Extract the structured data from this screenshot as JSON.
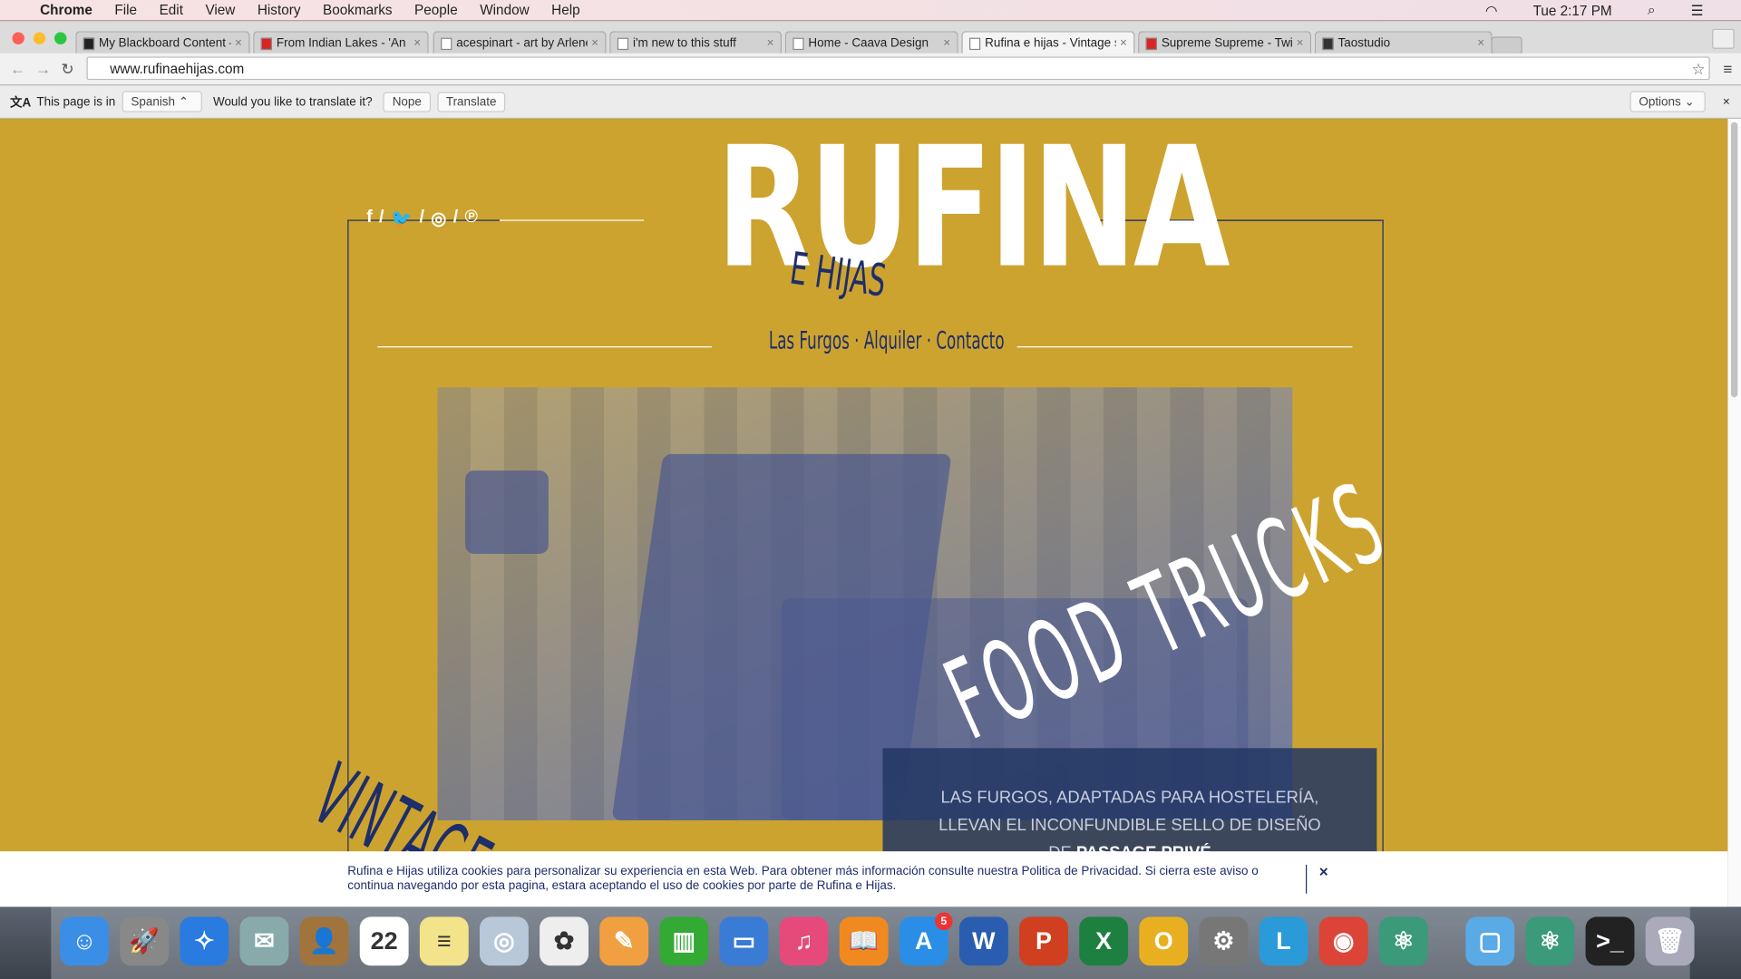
{
  "menubar": {
    "app": "Chrome",
    "items": [
      "File",
      "Edit",
      "View",
      "History",
      "Bookmarks",
      "People",
      "Window",
      "Help"
    ],
    "clock": "Tue 2:17 PM"
  },
  "tabs": [
    {
      "title": "My Blackboard Content – E",
      "fav": "#222"
    },
    {
      "title": "From Indian Lakes - 'An",
      "fav": "#d22"
    },
    {
      "title": "acespinart - art by Arlene E",
      "fav": "#fff"
    },
    {
      "title": "i'm new to this stuff",
      "fav": "#fff"
    },
    {
      "title": "Home - Caava Design",
      "fav": "#fff"
    },
    {
      "title": "Rufina e hijas - Vintage stre",
      "fav": "#fff"
    },
    {
      "title": "Supreme Supreme - Twice",
      "fav": "#d22"
    },
    {
      "title": "Taostudio",
      "fav": "#333"
    }
  ],
  "url": "www.rufinaehijas.com",
  "translate": {
    "prefix": "This page is in",
    "language": "Spanish",
    "question": "Would you like to translate it?",
    "nope": "Nope",
    "translate": "Translate",
    "options": "Options"
  },
  "site": {
    "logo": "RUFINA",
    "sublogo": "E HIJAS",
    "social": [
      "f",
      "🐦",
      "◎",
      "℗"
    ],
    "nav": [
      "Las Furgos",
      "Alquiler",
      "Contacto"
    ],
    "vintage": "VINTAGE STREET",
    "food": "FOOD TRUCKS",
    "box_line1": "LAS FURGOS, ADAPTADAS PARA HOSTELERÍA,",
    "box_line2": "LLEVAN EL INCONFUNDIBLE SELLO DE DISEÑO",
    "box_line3_prefix": "DE",
    "box_line3_bold": "PASSAGE PRIVÉ"
  },
  "cookie": {
    "text": "Rufina e Hijas utiliza cookies para personalizar su experiencia en esta Web. Para obtener más información consulte nuestra Politica de Privacidad. Si cierra este aviso o continua navegando por esta pagina, estara aceptando el uso de cookies por parte de Rufina e Hijas.",
    "close": "×"
  },
  "dock": [
    {
      "name": "Finder",
      "glyph": "☺",
      "color": "#3a8ee6"
    },
    {
      "name": "Launchpad",
      "glyph": "🚀",
      "color": "#888"
    },
    {
      "name": "Safari",
      "glyph": "✧",
      "color": "#2a7be0"
    },
    {
      "name": "Mail",
      "glyph": "✉",
      "color": "#8aa"
    },
    {
      "name": "Contacts",
      "glyph": "👤",
      "color": "#a0743c"
    },
    {
      "name": "Calendar",
      "glyph": "22",
      "color": "#fff"
    },
    {
      "name": "Notes",
      "glyph": "≡",
      "color": "#f3e38a"
    },
    {
      "name": "Preview",
      "glyph": "◎",
      "color": "#b8c8d8"
    },
    {
      "name": "Photos",
      "glyph": "✿",
      "color": "#eee"
    },
    {
      "name": "Pages",
      "glyph": "✎",
      "color": "#f0a040"
    },
    {
      "name": "Numbers",
      "glyph": "▥",
      "color": "#3a3"
    },
    {
      "name": "Keynote",
      "glyph": "▭",
      "color": "#3a7bd5"
    },
    {
      "name": "iTunes",
      "glyph": "♫",
      "color": "#e54a7a"
    },
    {
      "name": "iBooks",
      "glyph": "📖",
      "color": "#f08a20"
    },
    {
      "name": "App Store",
      "glyph": "A",
      "color": "#2a8ee6",
      "badge": "5"
    },
    {
      "name": "Word",
      "glyph": "W",
      "color": "#2a5db0"
    },
    {
      "name": "PowerPoint",
      "glyph": "P",
      "color": "#d04020"
    },
    {
      "name": "Excel",
      "glyph": "X",
      "color": "#1e8040"
    },
    {
      "name": "Outlook",
      "glyph": "O",
      "color": "#e8b020"
    },
    {
      "name": "System Preferences",
      "glyph": "⚙",
      "color": "#777"
    },
    {
      "name": "Lync",
      "glyph": "L",
      "color": "#2a9ad8"
    },
    {
      "name": "Chrome",
      "glyph": "◉",
      "color": "#db4437"
    },
    {
      "name": "Atom",
      "glyph": "⚛",
      "color": "#3a9a7a"
    },
    {
      "name": "Folder",
      "glyph": "▢",
      "color": "#5aaae6"
    },
    {
      "name": "Atom Helper",
      "glyph": "⚛",
      "color": "#3a9a7a"
    },
    {
      "name": "Terminal",
      "glyph": ">_",
      "color": "#222"
    },
    {
      "name": "Trash",
      "glyph": "🗑",
      "color": "#aab"
    }
  ]
}
